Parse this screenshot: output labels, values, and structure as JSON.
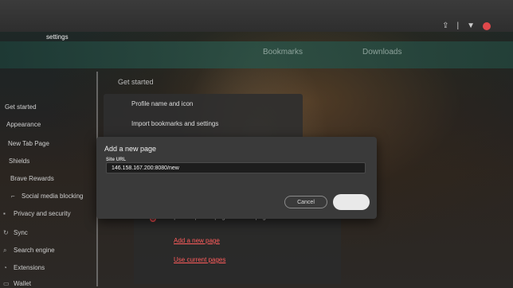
{
  "browser": {
    "tab_title": "settings",
    "bookmarks": [
      "Bookmarks",
      "Downloads"
    ]
  },
  "sidebar": {
    "items": [
      {
        "label": "Get started",
        "icon": "get-started-icon"
      },
      {
        "label": "Appearance",
        "icon": "appearance-icon"
      },
      {
        "label": "New Tab Page",
        "icon": "new-tab-icon"
      },
      {
        "label": "Shields",
        "icon": "shield-icon"
      },
      {
        "label": "Brave Rewards",
        "icon": "rewards-icon"
      },
      {
        "label": "Social media blocking",
        "icon": "social-icon"
      },
      {
        "label": "Privacy and security",
        "icon": "lock-icon"
      },
      {
        "label": "Sync",
        "icon": "sync-icon"
      },
      {
        "label": "Search engine",
        "icon": "search-icon"
      },
      {
        "label": "Extensions",
        "icon": "extensions-icon"
      },
      {
        "label": "Wallet",
        "icon": "wallet-icon"
      }
    ]
  },
  "main": {
    "section_heading": "Get started",
    "rows": [
      "Profile name and icon",
      "Import bookmarks and settings"
    ],
    "startup_option": "Open a specific page or set of pages",
    "add_page_link": "Add a new page",
    "use_current_link": "Use current pages"
  },
  "modal": {
    "title": "Add a new page",
    "field_label": "Site URL",
    "url_value": "146.158.167.200:8080/new",
    "cancel_label": "Cancel",
    "add_label": ""
  },
  "colors": {
    "accent": "#e0484b",
    "modal_bg": "#3a3a3a"
  }
}
